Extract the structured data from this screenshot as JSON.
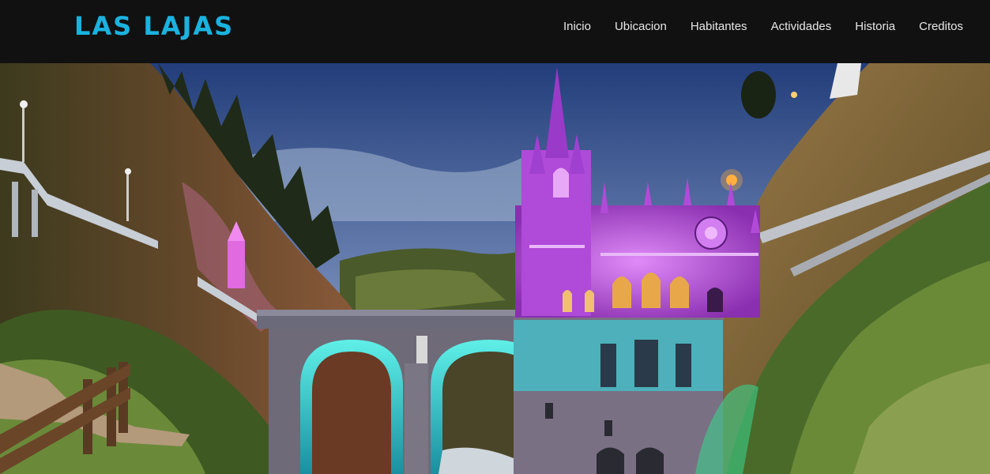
{
  "header": {
    "brand": "LAS LAJAS",
    "brand_color": "#1ab3e0",
    "nav": [
      "Inicio",
      "Ubicacion",
      "Habitantes",
      "Actividades",
      "Historia",
      "Creditos"
    ]
  },
  "hero": {
    "image": "sanctuary-photo",
    "colors": {
      "sky_top": "#2c4a8c",
      "sky_bottom": "#b9c6d9",
      "church_glow": "#c25be8",
      "bridge_glow": "#2fd6d0",
      "cliff": "#6b4a2c"
    }
  }
}
